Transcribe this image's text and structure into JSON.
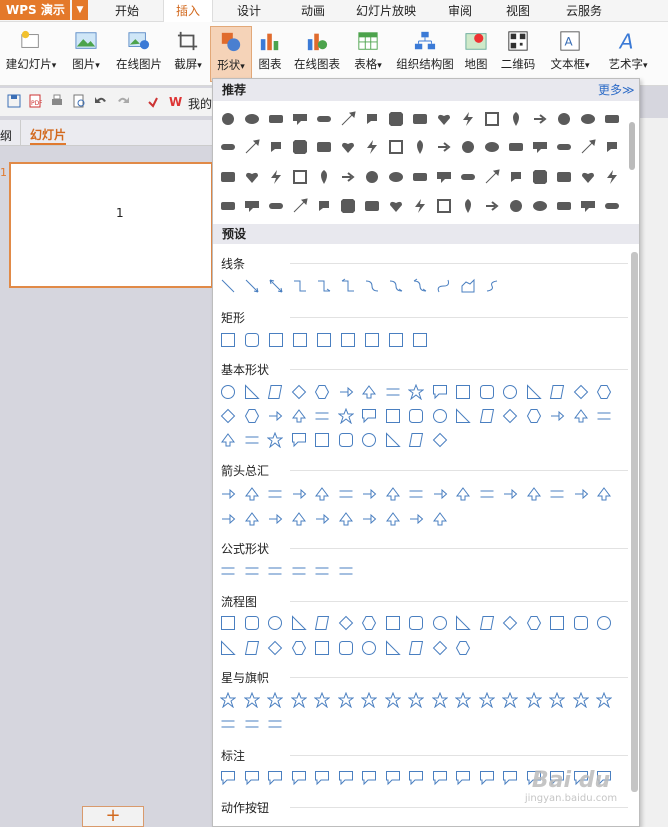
{
  "app": {
    "logo": "WPS 演示",
    "logo_arrow": "▼"
  },
  "tabs": [
    {
      "label": "开始"
    },
    {
      "label": "插入",
      "active": true
    },
    {
      "label": "设计"
    },
    {
      "label": "动画"
    },
    {
      "label": "幻灯片放映"
    },
    {
      "label": "审阅"
    },
    {
      "label": "视图"
    },
    {
      "label": "云服务"
    }
  ],
  "ribbon": [
    {
      "label": "建幻灯片",
      "arrow": "▾",
      "icon": "new-slide-icon"
    },
    {
      "label": "图片",
      "arrow": "▾",
      "icon": "picture-icon"
    },
    {
      "label": "在线图片",
      "arrow": "",
      "icon": "online-picture-icon"
    },
    {
      "label": "截屏",
      "arrow": "▾",
      "icon": "screenshot-icon"
    },
    {
      "label": "形状",
      "arrow": "▾",
      "icon": "shapes-icon",
      "selected": true
    },
    {
      "label": "图表",
      "arrow": "",
      "icon": "chart-icon"
    },
    {
      "label": "在线图表",
      "arrow": "",
      "icon": "online-chart-icon"
    },
    {
      "label": "表格",
      "arrow": "▾",
      "icon": "table-icon"
    },
    {
      "label": "组织结构图",
      "arrow": "",
      "icon": "org-chart-icon"
    },
    {
      "label": "地图",
      "arrow": "",
      "icon": "map-icon"
    },
    {
      "label": "二维码",
      "arrow": "",
      "icon": "qrcode-icon"
    },
    {
      "label": "文本框",
      "arrow": "▾",
      "icon": "textbox-icon"
    },
    {
      "label": "艺术字",
      "arrow": "▾",
      "icon": "wordart-icon"
    }
  ],
  "qat": {
    "my_label": "我的"
  },
  "pane": {
    "outline_tab": "纲",
    "slides_tab": "幻灯片",
    "slide_number": "1",
    "thumb_text": "1",
    "add_button": "+"
  },
  "shapes_panel": {
    "recommended": "推荐",
    "more": "更多≫",
    "presets": "预设",
    "sections": [
      "线条",
      "矩形",
      "基本形状",
      "箭头总汇",
      "公式形状",
      "流程图",
      "星与旗帜",
      "标注",
      "动作按钮"
    ]
  },
  "watermark": {
    "line1": "Bai du",
    "line2": "jingyan.baidu.com"
  },
  "colors": {
    "accent": "#e4792a",
    "link": "#2e6cc7"
  }
}
